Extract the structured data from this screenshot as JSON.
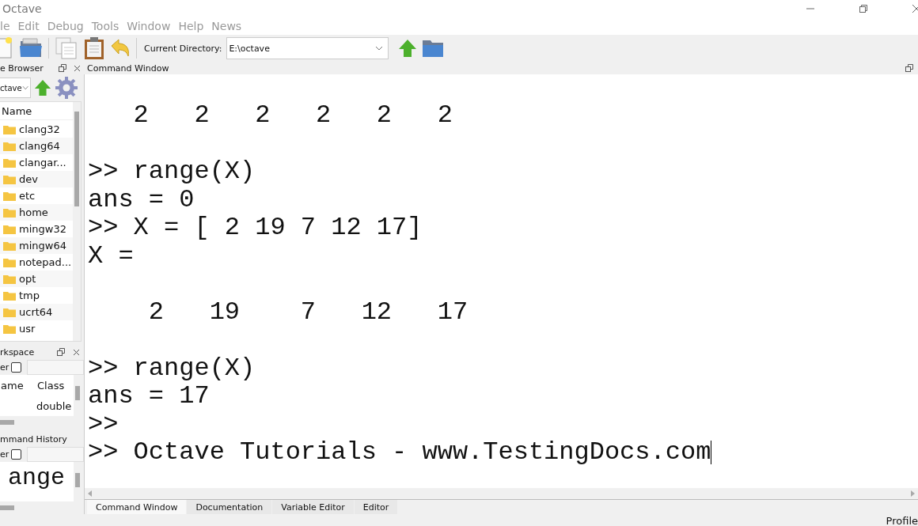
{
  "window": {
    "title": "Octave"
  },
  "menu": [
    "le",
    "Edit",
    "Debug",
    "Tools",
    "Window",
    "Help",
    "News"
  ],
  "toolbar": {
    "directory_label": "Current Directory:",
    "directory": "E:\\octave"
  },
  "file_browser": {
    "title": "e Browser",
    "path": "ctave",
    "column": "Name",
    "items": [
      "clang32",
      "clang64",
      "clangar...",
      "dev",
      "etc",
      "home",
      "mingw32",
      "mingw64",
      "notepad...",
      "opt",
      "tmp",
      "ucrt64",
      "usr"
    ]
  },
  "workspace": {
    "title": "rkspace",
    "filter_label": "er",
    "filter_checked": false,
    "columns": [
      "ame",
      "Class"
    ],
    "class_cells": [
      "double"
    ]
  },
  "command_history": {
    "title": "mmand History",
    "filter_label": "er",
    "filter_checked": false,
    "entries": [
      "ange"
    ]
  },
  "command_window": {
    "title": "Command Window",
    "lines": [
      {
        "kind": "text",
        "text": "   2   2   2   2   2   2"
      },
      {
        "kind": "blank"
      },
      {
        "kind": "text",
        "text": ">> range(X)"
      },
      {
        "kind": "text",
        "text": "ans = 0"
      },
      {
        "kind": "text",
        "text": ">> X = [ 2 19 7 12 17]"
      },
      {
        "kind": "text",
        "text": "X ="
      },
      {
        "kind": "blank"
      },
      {
        "kind": "text",
        "text": "    2   19    7   12   17"
      },
      {
        "kind": "blank"
      },
      {
        "kind": "text",
        "text": ">> range(X)"
      },
      {
        "kind": "text",
        "text": "ans = 17"
      },
      {
        "kind": "text",
        "text": ">>"
      },
      {
        "kind": "input",
        "text": ">> Octave Tutorials - www.TestingDocs.com"
      }
    ]
  },
  "tabs": [
    {
      "label": "Command Window",
      "selected": true
    },
    {
      "label": "Documentation",
      "selected": false
    },
    {
      "label": "Variable Editor",
      "selected": false
    },
    {
      "label": "Editor",
      "selected": false
    }
  ],
  "status_bar": {
    "text": "Profile"
  }
}
